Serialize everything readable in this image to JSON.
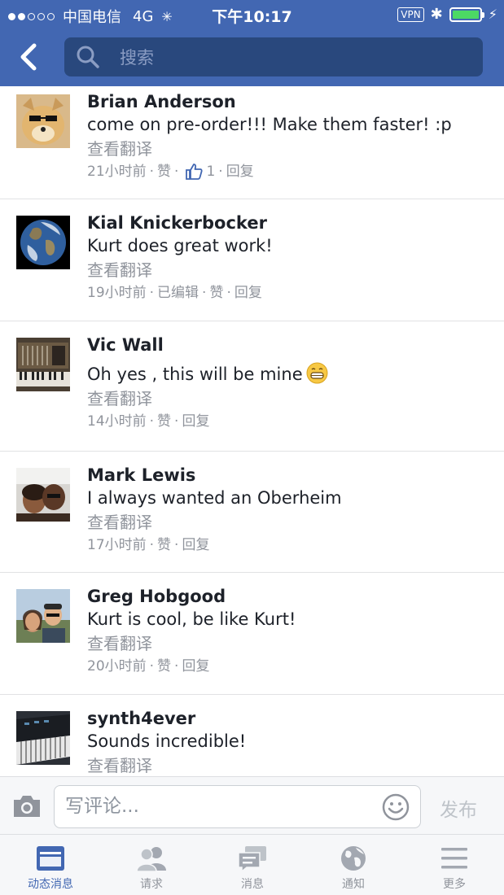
{
  "status_bar": {
    "carrier": "中国电信",
    "network": "4G",
    "time": "下午10:17",
    "vpn": "VPN",
    "colors": {
      "battery": "#4cd964"
    }
  },
  "header": {
    "search_placeholder": "搜索",
    "icons": {
      "back": "chevron-left-icon",
      "search": "search-icon"
    },
    "colors": {
      "background": "#4267b2",
      "search_bg": "#29487d"
    }
  },
  "comments": [
    {
      "author": "Brian Anderson",
      "text": "come on pre-order!!! Make them faster! :p",
      "translate": "查看翻译",
      "time": "21小时前",
      "like": "赞",
      "like_count": "1",
      "reply": "回复",
      "edited": ""
    },
    {
      "author": "Kial Knickerbocker",
      "text": "Kurt does great work!",
      "translate": "查看翻译",
      "time": "19小时前",
      "edited": "已编辑",
      "like": "赞",
      "reply": "回复"
    },
    {
      "author": "Vic Wall",
      "text": "Oh yes , this will be mine",
      "translate": "查看翻译",
      "time": "14小时前",
      "like": "赞",
      "reply": "回复"
    },
    {
      "author": "Mark Lewis",
      "text": "I always wanted an Oberheim",
      "translate": "查看翻译",
      "time": "17小时前",
      "like": "赞",
      "reply": "回复"
    },
    {
      "author": "Greg Hobgood",
      "text": "Kurt is cool, be like Kurt!",
      "translate": "查看翻译",
      "time": "20小时前",
      "like": "赞",
      "reply": "回复"
    },
    {
      "author": "synth4ever",
      "text": "Sounds incredible!",
      "translate": "查看翻译"
    }
  ],
  "meta_separator": "·",
  "composer": {
    "placeholder": "写评论...",
    "post_label": "发布",
    "icons": {
      "camera": "camera-icon",
      "emoji": "smiley-icon"
    }
  },
  "tab_bar": {
    "active_color": "#4267b2",
    "tabs": [
      {
        "label": "动态消息",
        "icon": "news-feed-icon",
        "active": true
      },
      {
        "label": "请求",
        "icon": "friend-requests-icon",
        "active": false
      },
      {
        "label": "消息",
        "icon": "messages-icon",
        "active": false
      },
      {
        "label": "通知",
        "icon": "globe-notifications-icon",
        "active": false
      },
      {
        "label": "更多",
        "icon": "menu-icon",
        "active": false
      }
    ]
  }
}
